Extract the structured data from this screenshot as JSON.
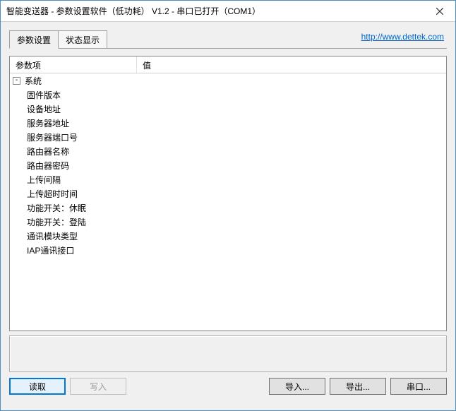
{
  "window": {
    "title": "智能变送器 - 参数设置软件（低功耗） V1.2 - 串口已打开（COM1）"
  },
  "link": {
    "text": "http://www.dettek.com"
  },
  "tabs": [
    {
      "label": "参数设置",
      "active": true
    },
    {
      "label": "状态显示",
      "active": false
    }
  ],
  "grid": {
    "header_param": "参数项",
    "header_value": "值",
    "category": "系统",
    "items": [
      {
        "label": "固件版本",
        "value": ""
      },
      {
        "label": "设备地址",
        "value": ""
      },
      {
        "label": "服务器地址",
        "value": ""
      },
      {
        "label": "服务器端口号",
        "value": ""
      },
      {
        "label": "路由器名称",
        "value": ""
      },
      {
        "label": "路由器密码",
        "value": ""
      },
      {
        "label": "上传间隔",
        "value": ""
      },
      {
        "label": "上传超时时间",
        "value": ""
      },
      {
        "label": "功能开关：休眠",
        "value": ""
      },
      {
        "label": "功能开关：登陆",
        "value": ""
      },
      {
        "label": "通讯模块类型",
        "value": ""
      },
      {
        "label": "IAP通讯接口",
        "value": ""
      }
    ]
  },
  "buttons": {
    "read": "读取",
    "write": "写入",
    "import": "导入...",
    "export": "导出...",
    "serial": "串口..."
  }
}
